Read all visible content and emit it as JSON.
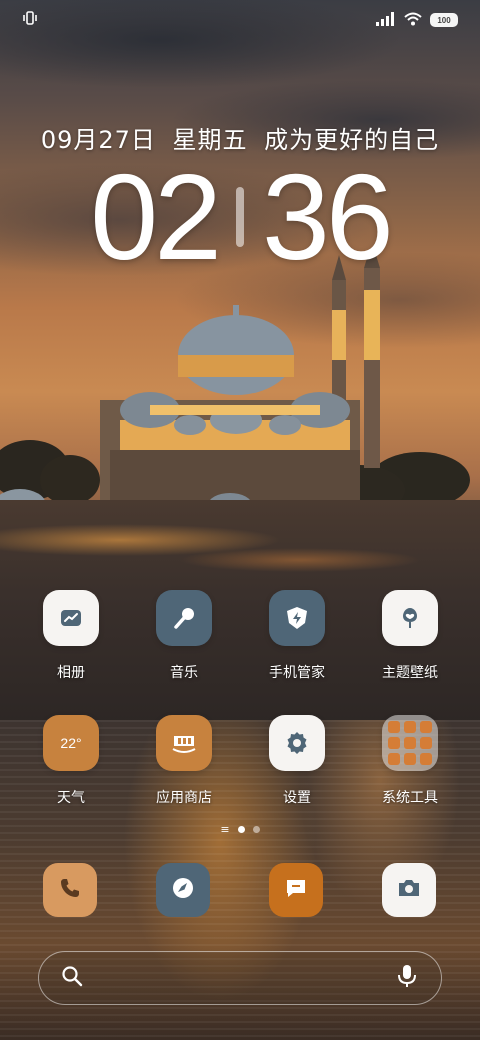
{
  "status_bar": {
    "left_icon": "vibrate-icon",
    "signal_icon": "signal-icon",
    "wifi_icon": "wifi-icon",
    "battery_text": "100"
  },
  "lock_info": {
    "date": "09月27日",
    "weekday": "星期五",
    "motto": "成为更好的自己",
    "hour": "02",
    "minute": "36"
  },
  "apps_row1": [
    {
      "label": "相册",
      "icon": "gallery-icon"
    },
    {
      "label": "音乐",
      "icon": "music-icon"
    },
    {
      "label": "手机管家",
      "icon": "phone-manager-icon"
    },
    {
      "label": "主题壁纸",
      "icon": "theme-wallpaper-icon"
    }
  ],
  "apps_row2": [
    {
      "label": "天气",
      "icon": "weather-icon",
      "temp": "22°"
    },
    {
      "label": "应用商店",
      "icon": "app-store-icon"
    },
    {
      "label": "设置",
      "icon": "settings-gear-icon"
    },
    {
      "label": "系统工具",
      "icon": "folder-icon"
    }
  ],
  "page_indicator": {
    "pages": 2,
    "current": 1,
    "menu_icon": "≡"
  },
  "dock": [
    {
      "icon": "phone-icon"
    },
    {
      "icon": "browser-icon"
    },
    {
      "icon": "messages-icon"
    },
    {
      "icon": "camera-icon"
    }
  ],
  "search_bar": {
    "left_icon": "search-icon",
    "right_icon": "microphone-icon"
  },
  "colors": {
    "white_icon_bg": "#f6f4f2",
    "slate_icon_bg": "#4f6677",
    "orange_icon_bg": "#c7823e",
    "icon_glyph_dark": "#4f6677"
  }
}
